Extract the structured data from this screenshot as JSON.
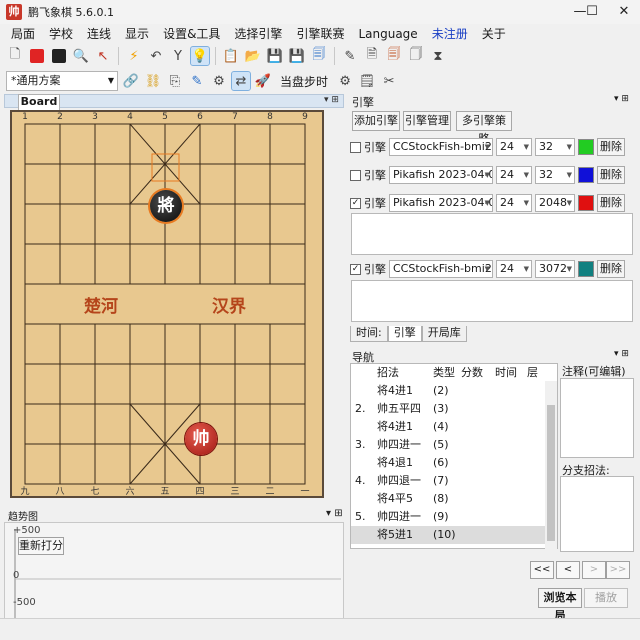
{
  "window": {
    "title": "鹏飞象棋 5.6.0.1",
    "logo_char": "帅",
    "minimize": "—",
    "maximize": "☐",
    "close": "✕"
  },
  "menu": [
    "局面",
    "学校",
    "连线",
    "显示",
    "设置&工具",
    "选择引擎",
    "引擎联赛",
    "Language",
    "未注册",
    "关于"
  ],
  "menu_colors": {
    "unregistered": "#1a3fc4"
  },
  "toolbar": {
    "scheme": "*通用方案",
    "step_label": "当盘步时"
  },
  "board_panel": {
    "tab": "Board",
    "files_top": [
      "1",
      "2",
      "3",
      "4",
      "5",
      "6",
      "7",
      "8",
      "9"
    ],
    "files_bottom": [
      "九",
      "八",
      "七",
      "六",
      "五",
      "四",
      "三",
      "二",
      "一"
    ],
    "river_left": "楚河",
    "river_right": "汉界",
    "pieces": {
      "black_general": "將",
      "red_general": "帅"
    }
  },
  "trend": {
    "title": "趋势图",
    "rescore": "重新打分",
    "y_top": "+500",
    "y_mid": "0",
    "y_bottom": "-500"
  },
  "engine_panel": {
    "title": "引擎",
    "add": "添加引擎",
    "manage": "引擎管理",
    "multi": "多引擎策略",
    "engines": [
      {
        "checked": false,
        "label": "引擎",
        "name": "CCStockFish-bmi2",
        "threads": "24",
        "hash": "32",
        "color": "#22cc22",
        "delete": "删除"
      },
      {
        "checked": false,
        "label": "引擎",
        "name": "Pikafish 2023-04-0",
        "threads": "24",
        "hash": "32",
        "color": "#1010d8",
        "delete": "删除"
      },
      {
        "checked": true,
        "label": "引擎",
        "name": "Pikafish 2023-04-0",
        "threads": "24",
        "hash": "2048",
        "color": "#e01010",
        "delete": "删除"
      },
      {
        "checked": true,
        "label": "引擎",
        "name": "CCStockFish-bmi2",
        "threads": "24",
        "hash": "3072",
        "color": "#118080",
        "delete": "删除"
      }
    ],
    "tabs": [
      "时间:",
      "引擎",
      "开局库"
    ]
  },
  "nav": {
    "title": "导航",
    "headers": {
      "move": "招法",
      "type": "类型",
      "score": "分数",
      "time": "时间",
      "depth": "层"
    },
    "rows": [
      {
        "num": "",
        "move": "将4进1",
        "type": "(2)"
      },
      {
        "num": "2.",
        "move": "帅五平四",
        "type": "(3)"
      },
      {
        "num": "",
        "move": "将4进1",
        "type": "(4)"
      },
      {
        "num": "3.",
        "move": "帅四进一",
        "type": "(5)"
      },
      {
        "num": "",
        "move": "将4退1",
        "type": "(6)"
      },
      {
        "num": "4.",
        "move": "帅四退一",
        "type": "(7)"
      },
      {
        "num": "",
        "move": "将4平5",
        "type": "(8)"
      },
      {
        "num": "5.",
        "move": "帅四进一",
        "type": "(9)"
      },
      {
        "num": "",
        "move": "将5进1",
        "type": "(10)"
      }
    ],
    "comment_label": "注释(可编辑)",
    "branch_label": "分支招法:",
    "first": "<<",
    "prev": "<",
    "next": ">",
    "last": ">>",
    "browse": "浏览本局",
    "play": "播放"
  }
}
